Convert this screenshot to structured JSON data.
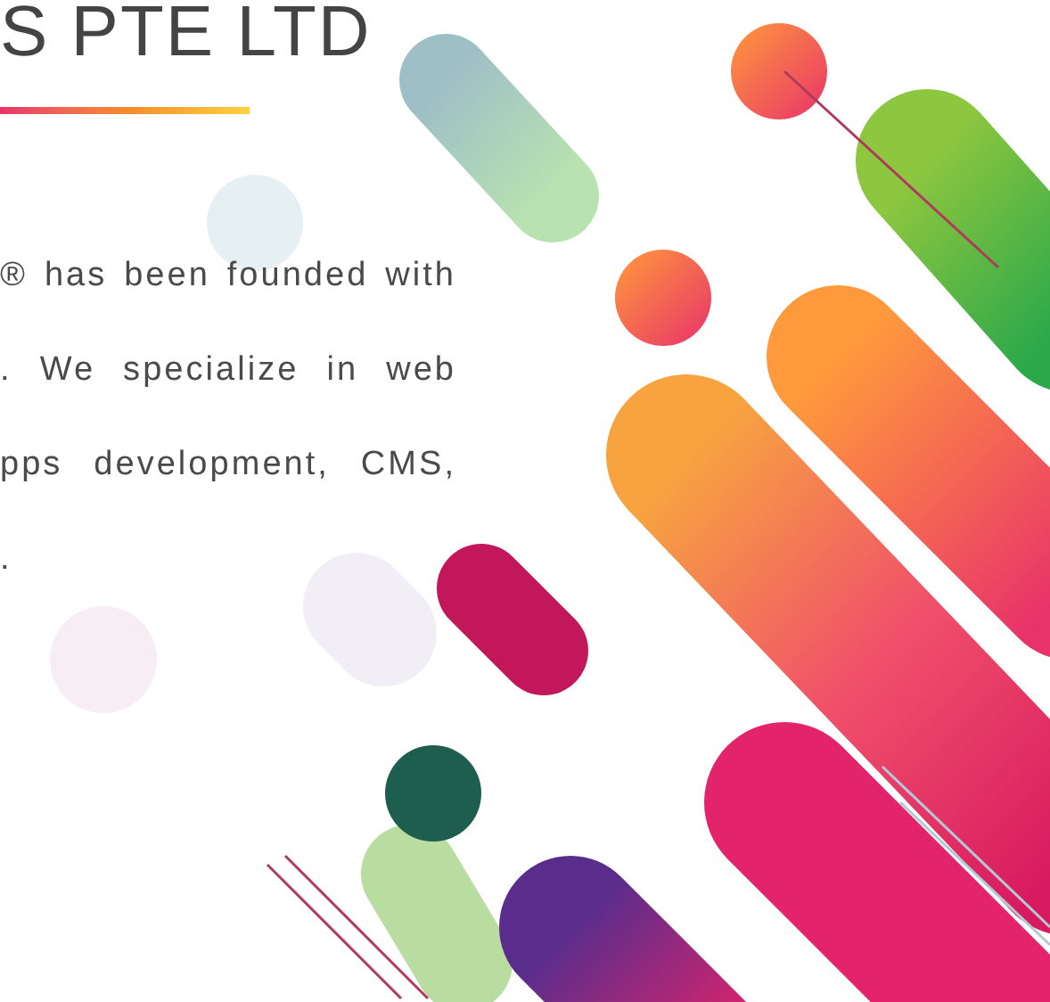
{
  "heading": "S PTE LTD",
  "paragraph_lines": [
    "® has been founded with",
    ". We specialize in web",
    "pps development, CMS,",
    "."
  ]
}
